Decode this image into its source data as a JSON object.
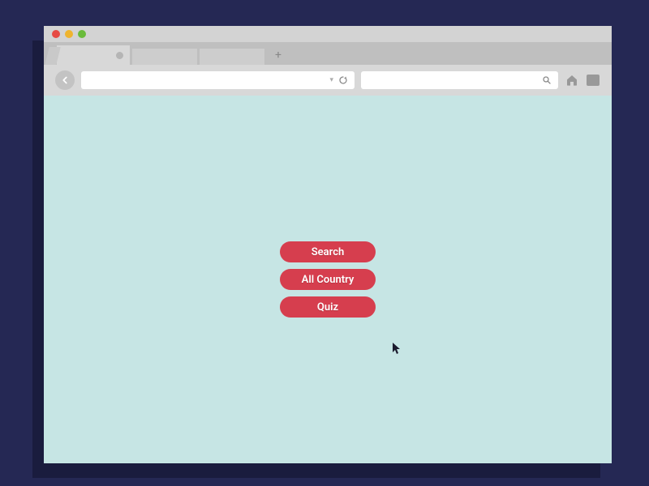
{
  "buttons": {
    "search": "Search",
    "all_country": "All Country",
    "quiz": "Quiz"
  },
  "colors": {
    "button_bg": "#d63e4e",
    "content_bg": "#c6e5e4",
    "page_bg": "#252854"
  }
}
